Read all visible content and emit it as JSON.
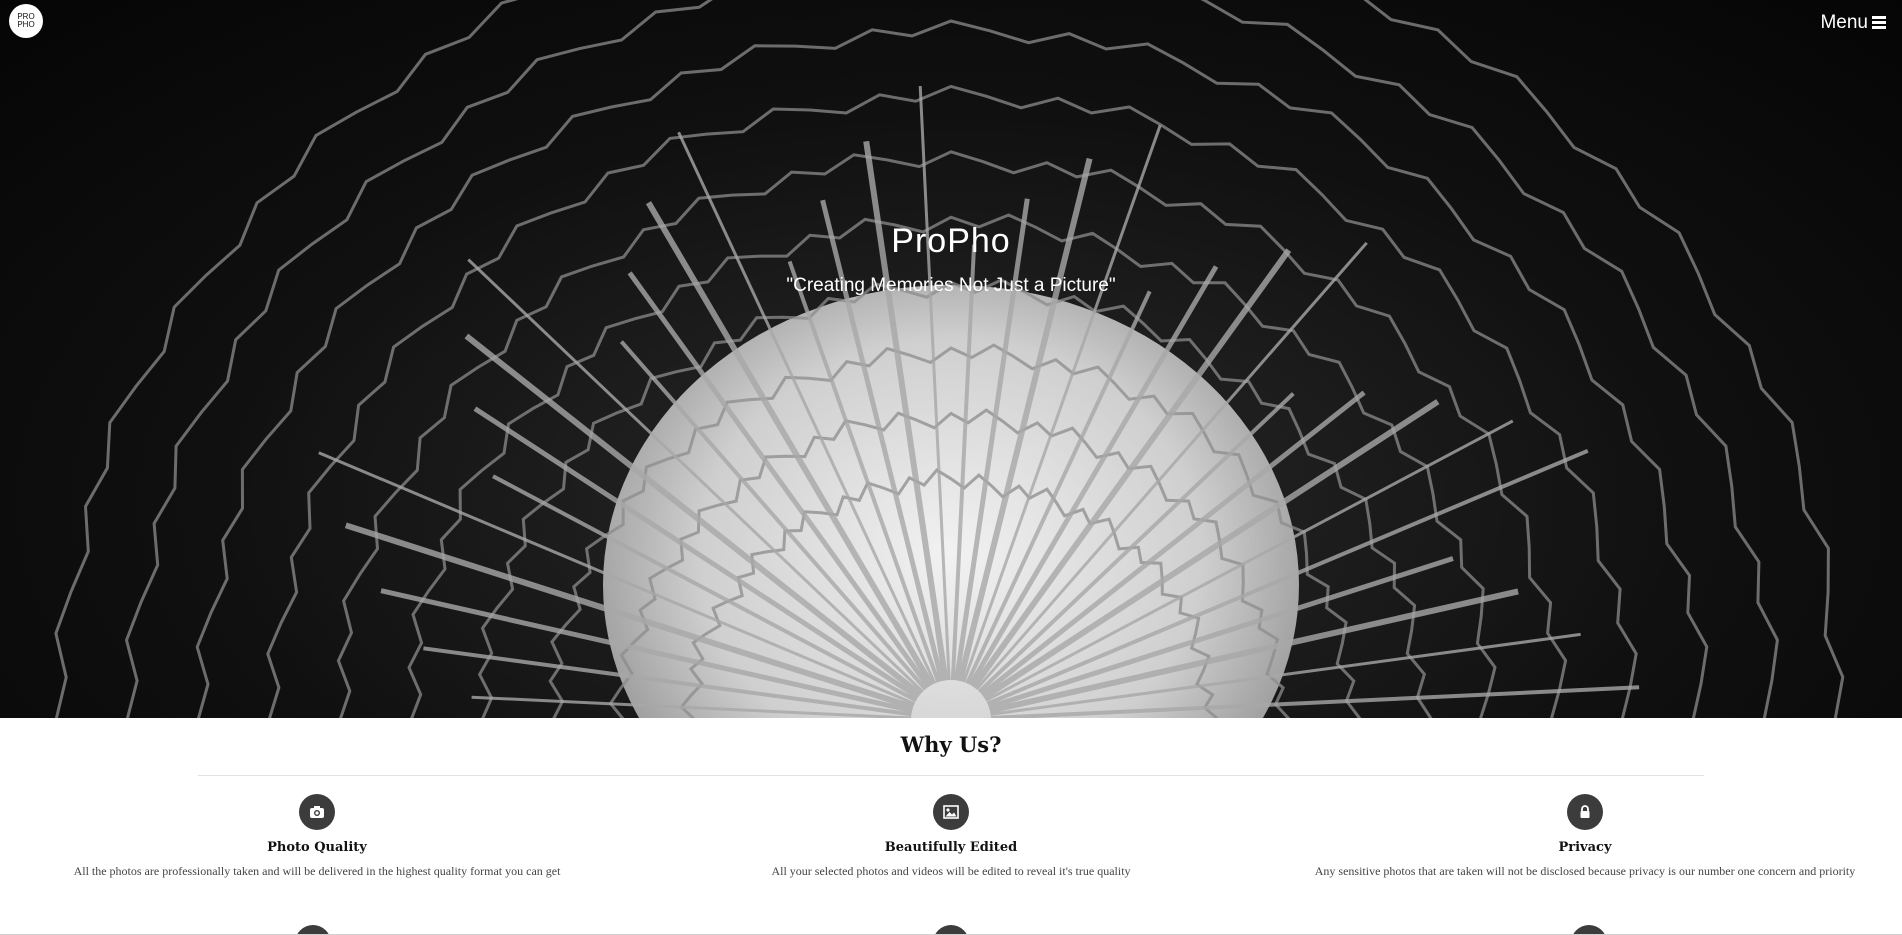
{
  "nav": {
    "logo_text": "PRO PHO",
    "menu_label": "Menu"
  },
  "hero": {
    "title": "ProPho",
    "tagline": "\"Creating Memories Not Just a Picture\""
  },
  "why_us": {
    "heading": "Why Us?",
    "features": [
      {
        "icon": "camera-icon",
        "title": "Photo Quality",
        "description": "All the photos are professionally taken and will be delivered in the highest quality format you can get"
      },
      {
        "icon": "image-icon",
        "title": "Beautifully Edited",
        "description": "All your selected photos and videos will be edited to reveal it's true quality"
      },
      {
        "icon": "lock-icon",
        "title": "Privacy",
        "description": "Any sensitive photos that are taken will not be disclosed because privacy is our number one concern and priority"
      }
    ]
  },
  "colors": {
    "icon_circle": "#3c3c3c",
    "hero_background": "#0a0a0a",
    "text_dark": "#111111"
  }
}
